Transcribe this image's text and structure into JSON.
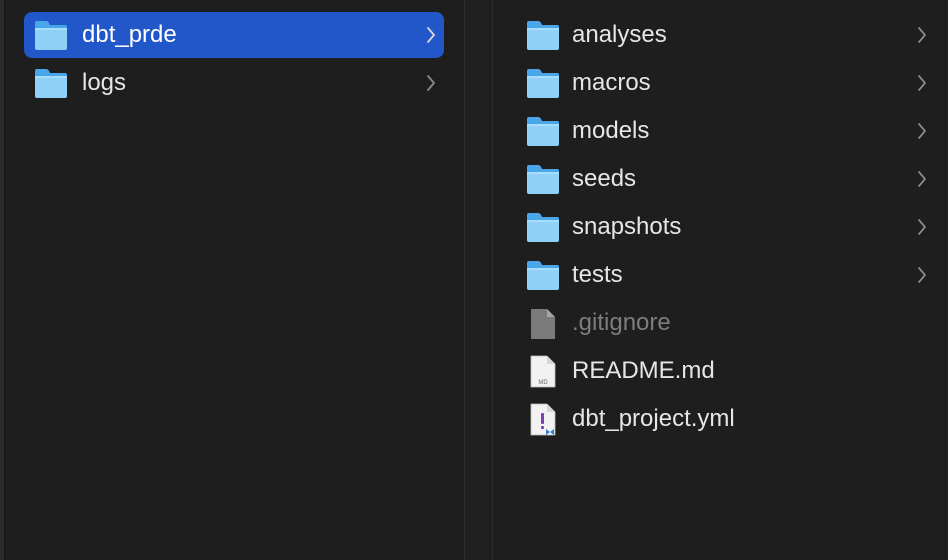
{
  "column1": {
    "items": [
      {
        "name": "dbt_prde",
        "kind": "folder",
        "selected": true
      },
      {
        "name": "logs",
        "kind": "folder",
        "selected": false
      }
    ]
  },
  "column2": {
    "items": [
      {
        "name": "analyses",
        "kind": "folder"
      },
      {
        "name": "macros",
        "kind": "folder"
      },
      {
        "name": "models",
        "kind": "folder"
      },
      {
        "name": "seeds",
        "kind": "folder"
      },
      {
        "name": "snapshots",
        "kind": "folder"
      },
      {
        "name": "tests",
        "kind": "folder"
      },
      {
        "name": ".gitignore",
        "kind": "hidden-file"
      },
      {
        "name": "README.md",
        "kind": "markdown-file",
        "icon_text": "MD"
      },
      {
        "name": "dbt_project.yml",
        "kind": "yaml-file"
      }
    ]
  },
  "icons": {
    "folder": "folder-icon",
    "chevron": "chevron-right-icon",
    "hidden_file": "generic-file-icon",
    "markdown_file": "markdown-file-icon",
    "yaml_file": "yaml-file-icon"
  },
  "colors": {
    "background": "#1e1e1e",
    "selection": "#2257c9",
    "folder_light": "#8fd0f7",
    "folder_dark": "#4aa6ea",
    "text": "#e6e6e6",
    "dim_text": "#7d7d7d"
  }
}
